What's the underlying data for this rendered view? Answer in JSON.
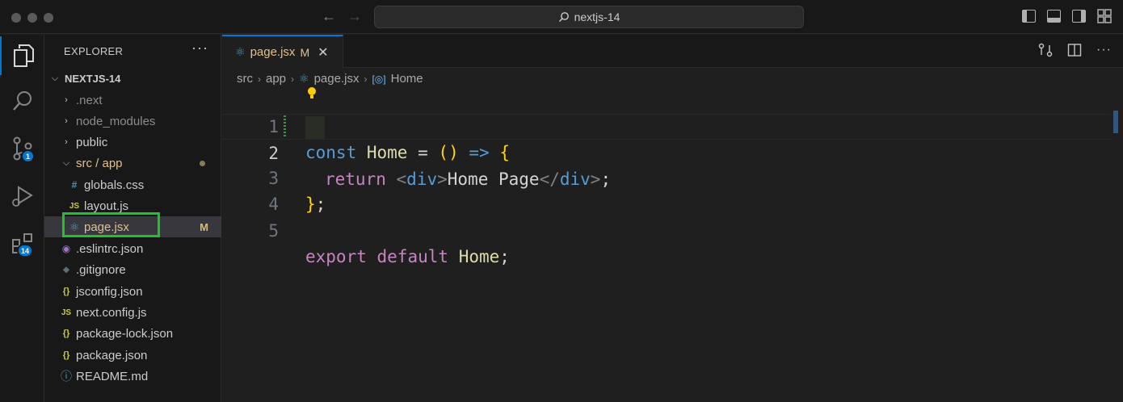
{
  "window": {
    "search_text": "nextjs-14"
  },
  "activity": {
    "scm_badge": "1",
    "extensions_badge": "14"
  },
  "explorer": {
    "title": "EXPLORER",
    "more": "···",
    "root": "NEXTJS-14",
    "items": [
      {
        "label": ".next",
        "kind": "folder",
        "icon": "chevron-right-icon"
      },
      {
        "label": "node_modules",
        "kind": "folder",
        "icon": "chevron-right-icon"
      },
      {
        "label": "public",
        "kind": "folder",
        "icon": "chevron-right-icon"
      },
      {
        "label": "src / app",
        "kind": "folder-open",
        "icon": "chevron-down-icon"
      },
      {
        "label": "globals.css",
        "kind": "file",
        "icon_glyph": "#",
        "icon_color": "#519aba"
      },
      {
        "label": "layout.js",
        "kind": "file",
        "icon_glyph": "JS",
        "icon_color": "#cbcb41"
      },
      {
        "label": "page.jsx",
        "kind": "file",
        "icon_glyph": "⚛",
        "icon_color": "#519aba",
        "modified": "M"
      },
      {
        "label": ".eslintrc.json",
        "kind": "file",
        "icon_glyph": "◉",
        "icon_color": "#a074c4"
      },
      {
        "label": ".gitignore",
        "kind": "file",
        "icon_glyph": "◆",
        "icon_color": "#41535b"
      },
      {
        "label": "jsconfig.json",
        "kind": "file",
        "icon_glyph": "{}",
        "icon_color": "#cbcb41"
      },
      {
        "label": "next.config.js",
        "kind": "file",
        "icon_glyph": "JS",
        "icon_color": "#cbcb41"
      },
      {
        "label": "package-lock.json",
        "kind": "file",
        "icon_glyph": "{}",
        "icon_color": "#cbcb41"
      },
      {
        "label": "package.json",
        "kind": "file",
        "icon_glyph": "{}",
        "icon_color": "#cbcb41"
      },
      {
        "label": "README.md",
        "kind": "file",
        "icon_glyph": "ⓘ",
        "icon_color": "#519aba"
      }
    ]
  },
  "editor": {
    "tab": {
      "label": "page.jsx",
      "modified": "M",
      "close": "✕"
    },
    "breadcrumb": {
      "src": "src",
      "app": "app",
      "file": "page.jsx",
      "symbol": "Home"
    },
    "lines": [
      {
        "num": "1"
      },
      {
        "num": "2"
      },
      {
        "num": "3"
      },
      {
        "num": "4"
      },
      {
        "num": "5"
      }
    ],
    "code": {
      "l1": {
        "kw": "const",
        "id": "Home",
        "eq": "=",
        "paren": "()",
        "arrow": "=>",
        "brace": "{"
      },
      "l2": {
        "kw": "return",
        "lt": "<",
        "tag": "div",
        "gt": ">",
        "text": "Home Page",
        "lt2": "</",
        "tag2": "div",
        "gt2": ">",
        "semi": ";"
      },
      "l3": {
        "brace": "}",
        "semi": ";"
      },
      "l5": {
        "kw1": "export",
        "kw2": "default",
        "id": "Home",
        "semi": ";"
      }
    }
  }
}
